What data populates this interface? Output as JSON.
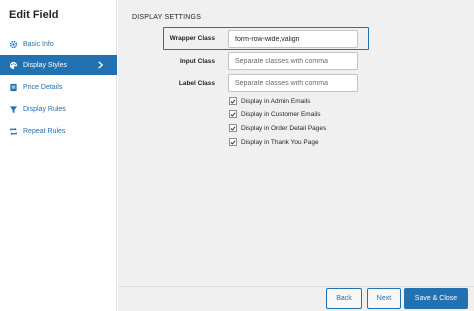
{
  "dialog": {
    "title": "Edit Field"
  },
  "sidebar": {
    "items": [
      {
        "label": "Basic Info",
        "icon": "gear-icon"
      },
      {
        "label": "Display Styles",
        "icon": "palette-icon",
        "active": true
      },
      {
        "label": "Price Details",
        "icon": "tag-icon"
      },
      {
        "label": "Display Rules",
        "icon": "filter-icon"
      },
      {
        "label": "Repeat Rules",
        "icon": "repeat-icon"
      }
    ]
  },
  "main": {
    "section_title": "DISPLAY SETTINGS",
    "fields": [
      {
        "label": "Wrapper Class",
        "value": "form-row-wide,valign",
        "placeholder": ""
      },
      {
        "label": "Input Class",
        "value": "",
        "placeholder": "Separate classes with comma"
      },
      {
        "label": "Label Class",
        "value": "",
        "placeholder": "Separate classes with comma"
      }
    ],
    "checkboxes": [
      {
        "label": "Display in Admin Emails",
        "checked": true
      },
      {
        "label": "Display in Customer Emails",
        "checked": true
      },
      {
        "label": "Display in Order Detail Pages",
        "checked": true
      },
      {
        "label": "Display in Thank You Page",
        "checked": true
      }
    ]
  },
  "footer": {
    "back_label": "Back",
    "next_label": "Next",
    "save_label": "Save & Close"
  },
  "colors": {
    "accent": "#2271b1",
    "background": "#f0f0f1"
  }
}
